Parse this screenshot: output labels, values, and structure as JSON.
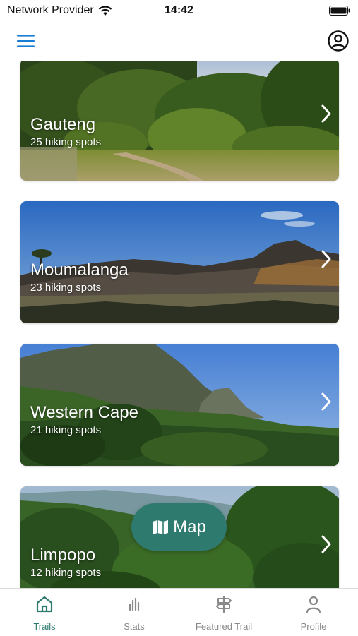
{
  "status_bar": {
    "carrier": "Network Provider",
    "time": "14:42"
  },
  "header": {
    "menu_icon": "hamburger-menu-icon",
    "profile_icon": "user-circle-icon"
  },
  "regions": [
    {
      "name": "Gauteng",
      "count_text": "25 hiking spots"
    },
    {
      "name": "Moumalanga",
      "count_text": "23 hiking spots"
    },
    {
      "name": "Western Cape",
      "count_text": "21 hiking spots"
    },
    {
      "name": "Limpopo",
      "count_text": "12 hiking spots"
    }
  ],
  "map_button": {
    "label": "Map",
    "icon": "folded-map-icon"
  },
  "tabs": [
    {
      "label": "Trails",
      "icon": "home-icon",
      "active": true
    },
    {
      "label": "Stats",
      "icon": "bar-chart-icon",
      "active": false
    },
    {
      "label": "Featured Trail",
      "icon": "signpost-icon",
      "active": false
    },
    {
      "label": "Profile",
      "icon": "person-icon",
      "active": false
    }
  ],
  "colors": {
    "accent": "#2f7a6e",
    "menu_icon": "#1a7fd4",
    "inactive_tab": "#8a8a8a"
  }
}
